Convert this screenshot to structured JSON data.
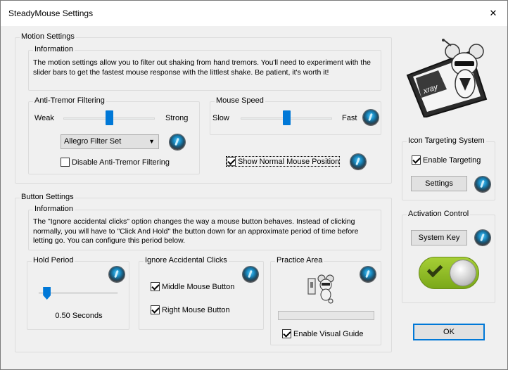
{
  "window": {
    "title": "SteadyMouse Settings",
    "close_glyph": "✕"
  },
  "motion": {
    "group_label": "Motion Settings",
    "info_label": "Information",
    "info_text": "The motion settings allow you to filter out shaking from hand tremors. You'll need to experiment with the slider bars to get the fastest mouse response with the littlest shake. Be patient, it's worth it!",
    "anti_tremor": {
      "label": "Anti-Tremor Filtering",
      "weak": "Weak",
      "strong": "Strong",
      "slider_level": 0.5,
      "filter_select": "Allegro Filter Set",
      "disable_label": "Disable Anti-Tremor Filtering",
      "disable_checked": false
    },
    "mouse_speed": {
      "label": "Mouse Speed",
      "slow": "Slow",
      "fast": "Fast",
      "slider_level": 0.5
    },
    "show_normal_label": "Show Normal Mouse Position",
    "show_normal_checked": true
  },
  "button": {
    "group_label": "Button Settings",
    "info_label": "Information",
    "info_text": "The \"Ignore accidental clicks\" option changes the way a mouse button behaves. Instead of clicking normally, you will have to \"Click And Hold\" the button down for an approximate period of time before letting go. You can configure this period below.",
    "hold_period": {
      "label": "Hold Period",
      "value_text": "0.50 Seconds",
      "slider_level": 0.1
    },
    "ignore_clicks": {
      "label": "Ignore Accidental Clicks",
      "middle_label": "Middle Mouse Button",
      "middle_checked": true,
      "right_label": "Right Mouse Button",
      "right_checked": true
    },
    "practice": {
      "label": "Practice Area",
      "progress": 0.0,
      "visual_guide_label": "Enable Visual Guide",
      "visual_guide_checked": true
    }
  },
  "icon_targeting": {
    "label": "Icon Targeting System",
    "enable_label": "Enable Targeting",
    "enable_checked": true,
    "settings_button": "Settings"
  },
  "activation": {
    "label": "Activation Control",
    "system_key_button": "System Key",
    "toggle_on": true
  },
  "logo_text": "xray",
  "ok_button": "OK",
  "colors": {
    "accent": "#0078d7",
    "toggle_green": "#8fbf27"
  }
}
